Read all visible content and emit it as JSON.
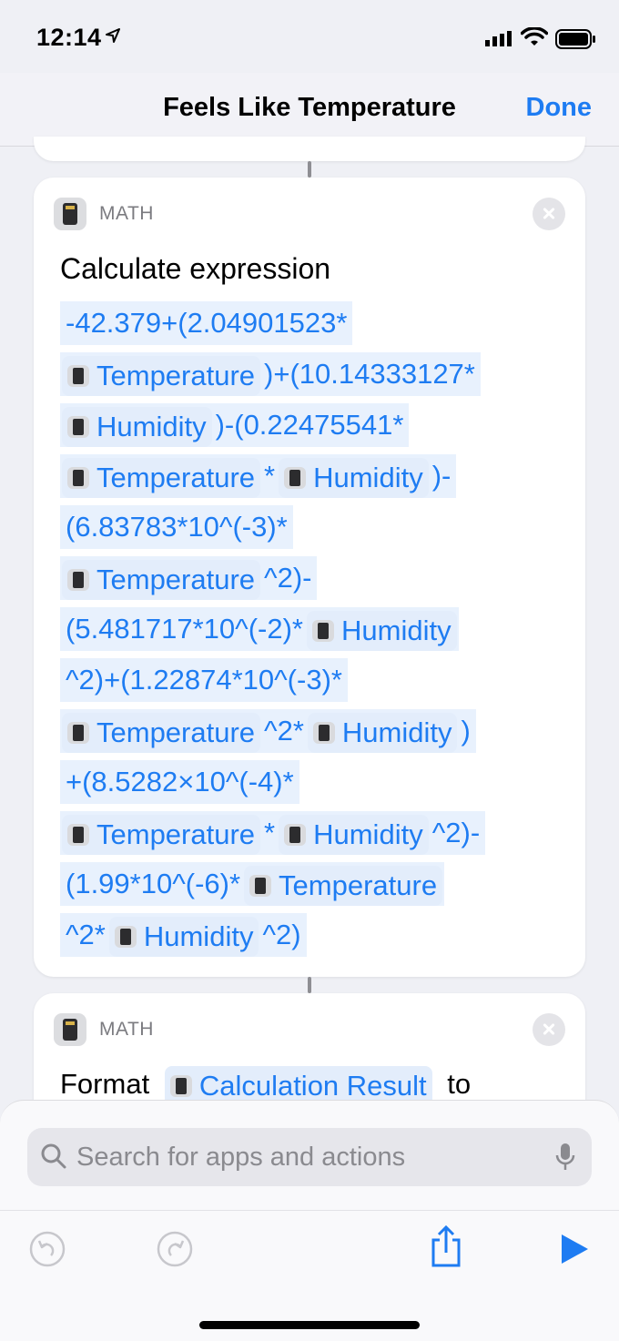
{
  "status_bar": {
    "time": "12:14"
  },
  "nav": {
    "title": "Feels Like Temperature",
    "done_label": "Done"
  },
  "card1": {
    "label": "MATH",
    "title": "Calculate expression",
    "lines": [
      [
        {
          "t": "-42.379+(2.04901523*"
        }
      ],
      [
        {
          "v": "Temperature"
        },
        {
          "t": ")+(10.14333127*"
        }
      ],
      [
        {
          "v": "Humidity"
        },
        {
          "t": ")-(0.22475541*"
        }
      ],
      [
        {
          "v": "Temperature"
        },
        {
          "t": "*"
        },
        {
          "v": "Humidity"
        },
        {
          "t": ")-"
        }
      ],
      [
        {
          "t": "(6.83783*10^(-3)*"
        }
      ],
      [
        {
          "v": "Temperature"
        },
        {
          "t": "^2)-"
        }
      ],
      [
        {
          "t": "(5.481717*10^(-2)*"
        },
        {
          "v": "Humidity"
        }
      ],
      [
        {
          "t": "^2)+(1.22874*10^(-3)*"
        }
      ],
      [
        {
          "v": "Temperature"
        },
        {
          "t": "^2*"
        },
        {
          "v": "Humidity"
        },
        {
          "t": ")"
        }
      ],
      [
        {
          "t": "+(8.5282×10^(-4)*"
        }
      ],
      [
        {
          "v": "Temperature"
        },
        {
          "t": "*"
        },
        {
          "v": "Humidity"
        },
        {
          "t": "^2)-"
        }
      ],
      [
        {
          "t": "(1.99*10^(-6)*"
        },
        {
          "v": "Temperature"
        }
      ],
      [
        {
          "t": "^2*"
        },
        {
          "v": "Humidity"
        },
        {
          "t": "^2)"
        }
      ]
    ]
  },
  "card2": {
    "label": "MATH",
    "format_label": "Format",
    "variable": "Calculation Result",
    "to_label": "to"
  },
  "search": {
    "placeholder": "Search for apps and actions"
  },
  "colors": {
    "accent": "#1e7cf2",
    "token_bg": "#e3edfb"
  }
}
